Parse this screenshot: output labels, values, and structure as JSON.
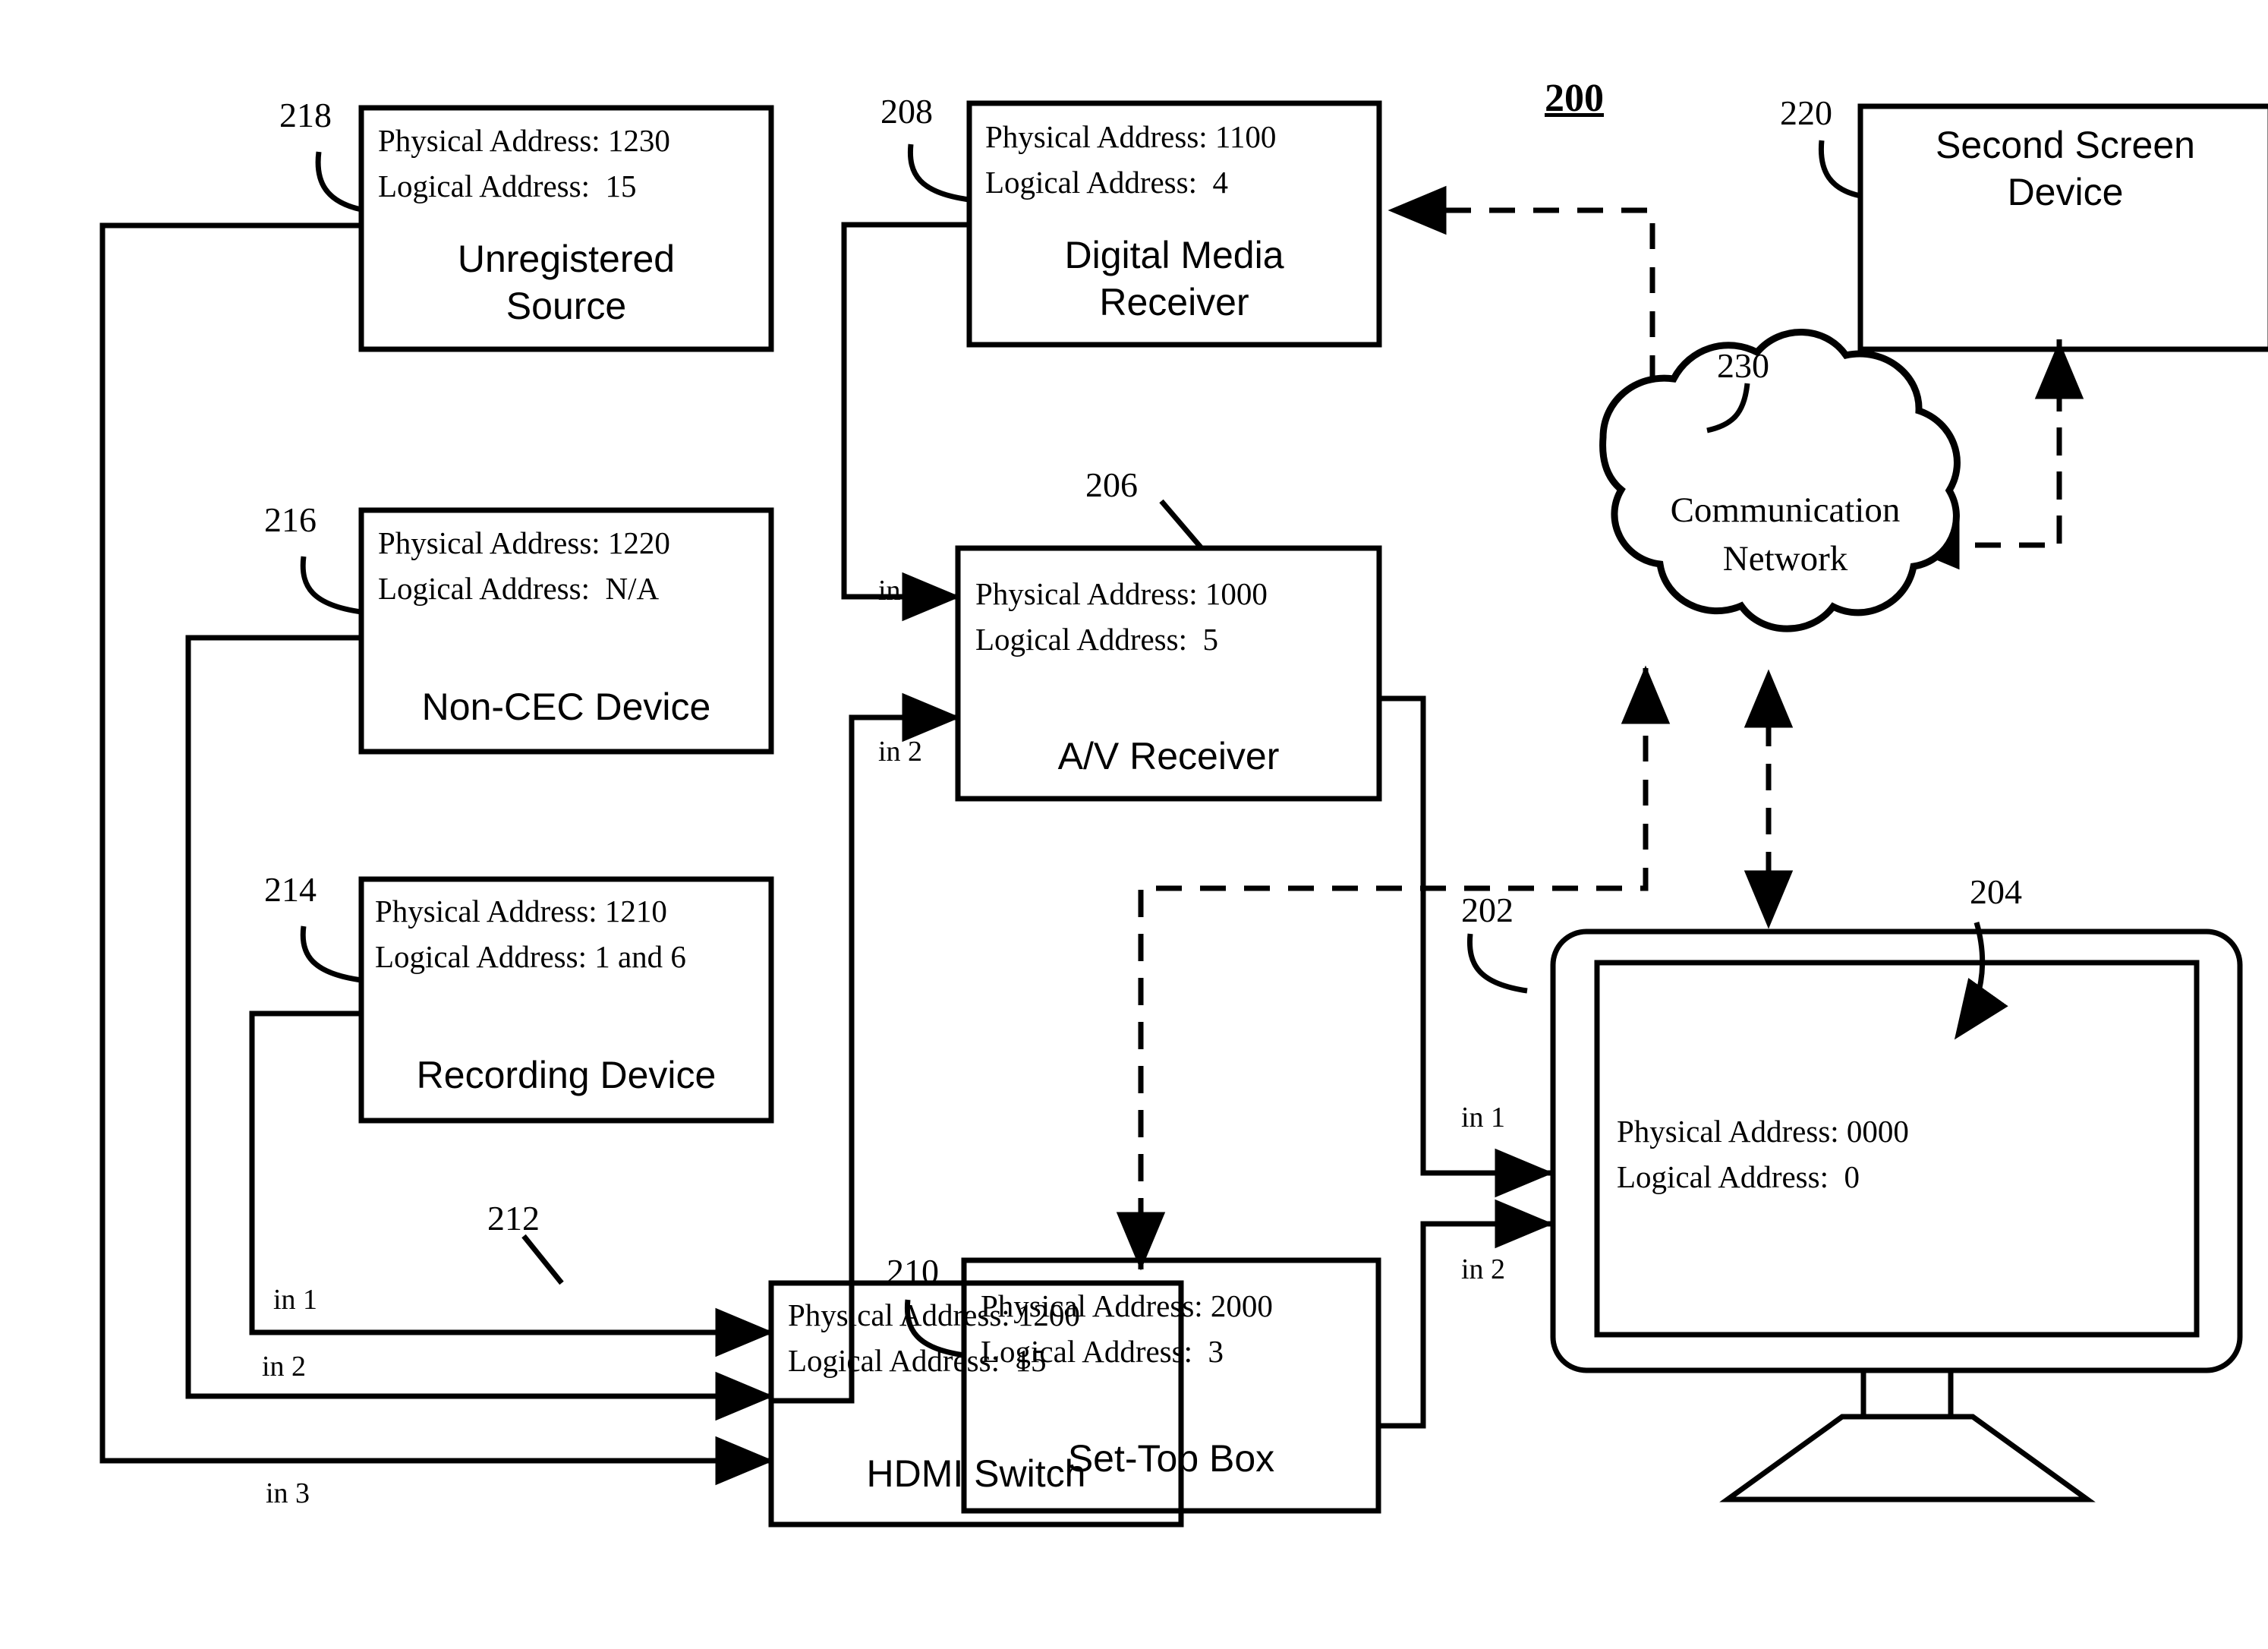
{
  "figure": {
    "number": "200",
    "labels": {
      "physical_address_prefix": "Physical Address: ",
      "logical_address_prefix": "Logical Address: "
    }
  },
  "devices": [
    {
      "id": "unregistered-source",
      "ref": "218",
      "name": "Unregistered\nSource",
      "physical_address": "Physical Address: 1230",
      "logical_address": "Logical Address:  15"
    },
    {
      "id": "non-cec-device",
      "ref": "216",
      "name": "Non-CEC Device",
      "physical_address": "Physical Address: 1220",
      "logical_address": "Logical Address:  N/A"
    },
    {
      "id": "recording-device",
      "ref": "214",
      "name": "Recording Device",
      "physical_address": "Physical Address: 1210",
      "logical_address": "Logical Address: 1 and 6"
    },
    {
      "id": "hdmi-switch",
      "ref": "212",
      "name": "HDMI Switch",
      "physical_address": "Physical Address: 1200",
      "logical_address": "Logical Address:  15"
    },
    {
      "id": "digital-media-receiver",
      "ref": "208",
      "name": "Digital Media\nReceiver",
      "physical_address": "Physical Address: 1100",
      "logical_address": "Logical Address:  4"
    },
    {
      "id": "av-receiver",
      "ref": "206",
      "name": "A/V Receiver",
      "physical_address": "Physical Address: 1000",
      "logical_address": "Logical Address:  5"
    },
    {
      "id": "set-top-box",
      "ref": "210",
      "name": "Set-Top Box",
      "physical_address": "Physical Address: 2000",
      "logical_address": "Logical Address:  3"
    },
    {
      "id": "television",
      "ref": "202",
      "ref_screen": "204",
      "name": "",
      "physical_address": "Physical Address: 0000",
      "logical_address": "Logical Address:  0"
    },
    {
      "id": "second-screen-device",
      "ref": "220",
      "name": "Second Screen\nDevice"
    },
    {
      "id": "communication-network",
      "ref": "230",
      "name": "Communication\nNetwork"
    }
  ],
  "ports": {
    "hdmi_switch": [
      "in 1",
      "in 2",
      "in 3"
    ],
    "av_receiver": [
      "in 1",
      "in 2"
    ],
    "television": [
      "in 1",
      "in 2"
    ]
  },
  "colors": {
    "stroke": "#000000",
    "background": "#ffffff"
  }
}
